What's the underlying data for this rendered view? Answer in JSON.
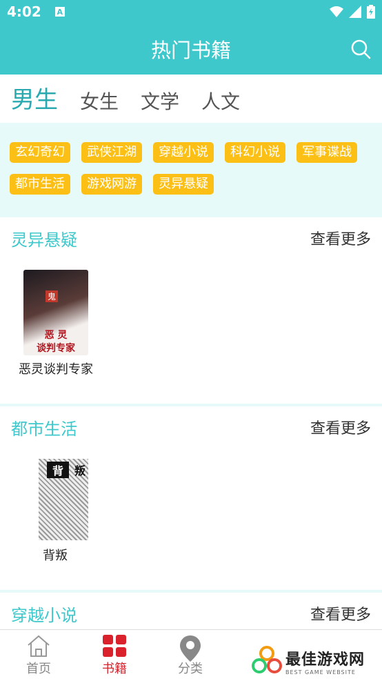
{
  "status_bar": {
    "time": "4:02",
    "notif_letter": "A"
  },
  "app_bar": {
    "title": "热门书籍"
  },
  "tabs": [
    {
      "label": "男生"
    },
    {
      "label": "女生"
    },
    {
      "label": "文学"
    },
    {
      "label": "人文"
    }
  ],
  "categories": [
    "玄幻奇幻",
    "武侠江湖",
    "穿越小说",
    "科幻小说",
    "军事谍战",
    "都市生活",
    "游戏网游",
    "灵异悬疑"
  ],
  "sections": [
    {
      "title": "灵异悬疑",
      "more": "查看更多",
      "book": "恶灵谈判专家",
      "cover_text_1": "恶 灵",
      "cover_text_2": "谈判专家",
      "cover_stamp": "鬼"
    },
    {
      "title": "都市生活",
      "more": "查看更多",
      "book": "背叛",
      "cover_text_1": "背",
      "cover_text_2": "叛"
    },
    {
      "title": "穿越小说",
      "more": "查看更多"
    }
  ],
  "bottom_nav": [
    {
      "label": "首页",
      "icon": "home-icon"
    },
    {
      "label": "书籍",
      "icon": "grid-icon"
    },
    {
      "label": "分类",
      "icon": "location-pin-icon"
    }
  ],
  "watermark": {
    "text": "最佳游戏网",
    "sub": "BEST GAME WEBSITE"
  },
  "colors": {
    "primary": "#3ec8cc",
    "chip": "#fbbf15",
    "active_nav": "#d9222c",
    "section_bg": "#e6fafa"
  }
}
